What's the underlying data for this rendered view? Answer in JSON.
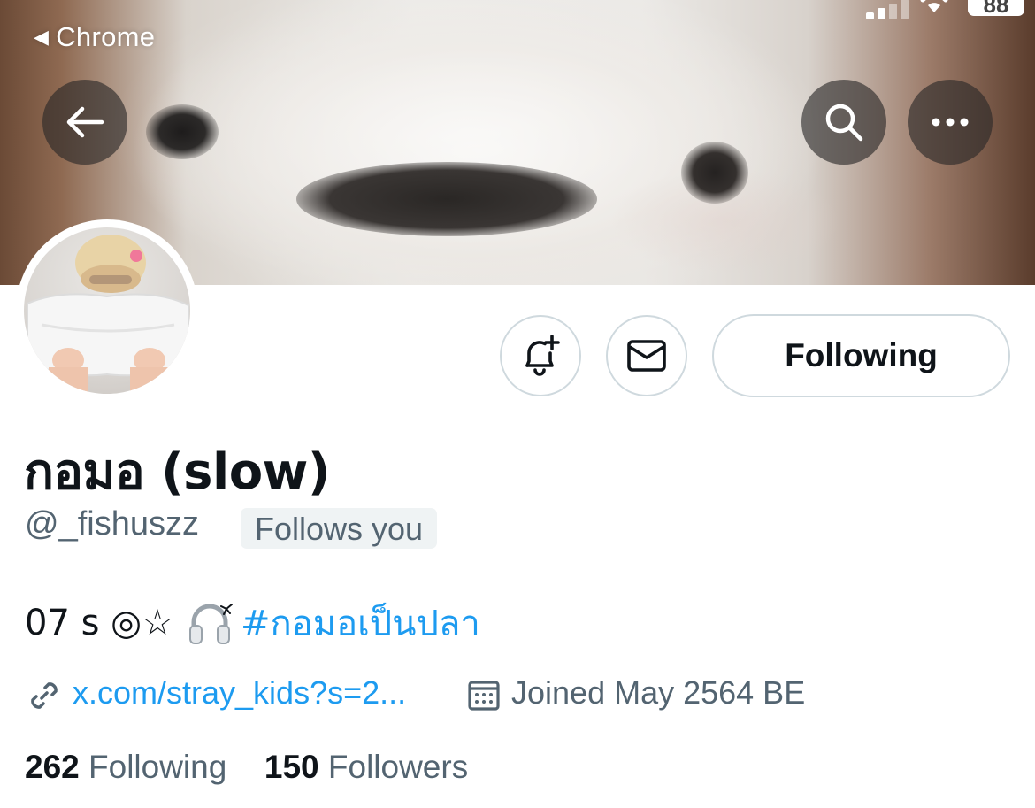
{
  "status_bar": {
    "back_app_label": "Chrome",
    "battery_level": "88"
  },
  "header": {
    "back_button_icon": "arrow-left-icon",
    "search_button_icon": "search-icon",
    "more_button_icon": "more-horizontal-icon"
  },
  "actions": {
    "notify_icon": "bell-plus-icon",
    "message_icon": "mail-icon",
    "following_label": "Following"
  },
  "profile": {
    "display_name": "กอมอ (slow)",
    "handle": "@_fishuszz",
    "follows_you_label": "Follows you",
    "bio_text": "07 s ◎☆",
    "bio_hashtag": "#กอมอเป็นปลา",
    "link_text": "x.com/stray_kids?s=2...",
    "joined_text": "Joined May 2564 BE",
    "following_count": "262",
    "following_label": "Following",
    "followers_count": "150",
    "followers_label": "Followers"
  },
  "colors": {
    "link_blue": "#1d9bf0",
    "secondary_text": "#536471",
    "primary_text": "#0f1419",
    "border": "#cfd9de"
  }
}
